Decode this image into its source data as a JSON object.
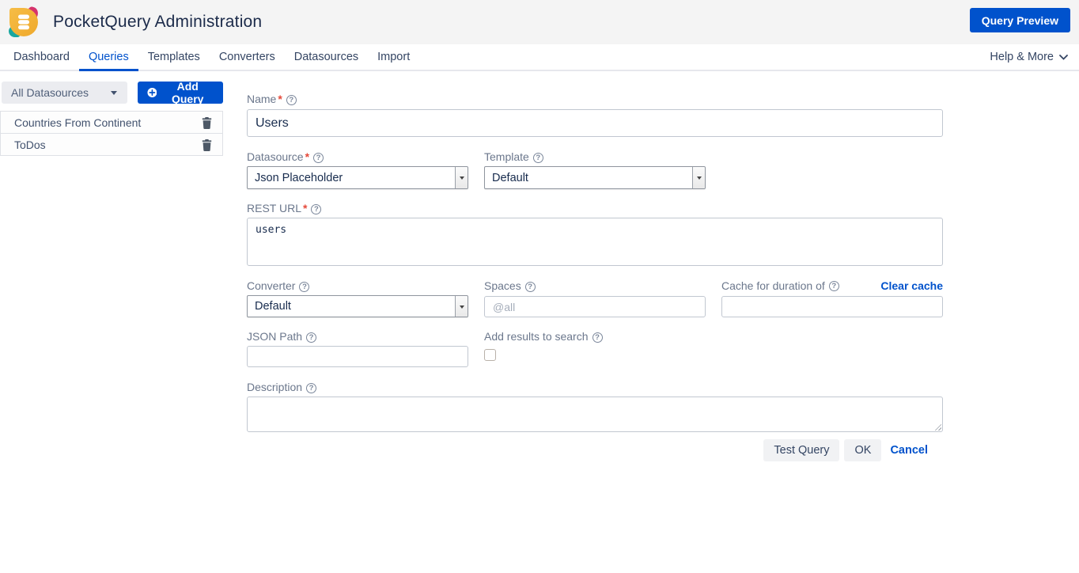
{
  "header": {
    "title": "PocketQuery Administration",
    "query_preview_label": "Query Preview"
  },
  "nav": {
    "items": [
      {
        "label": "Dashboard",
        "active": false
      },
      {
        "label": "Queries",
        "active": true
      },
      {
        "label": "Templates",
        "active": false
      },
      {
        "label": "Converters",
        "active": false
      },
      {
        "label": "Datasources",
        "active": false
      },
      {
        "label": "Import",
        "active": false
      }
    ],
    "help_label": "Help & More"
  },
  "sidebar": {
    "datasource_filter_value": "All Datasources",
    "add_query_label": "Add Query",
    "queries": [
      {
        "name": "Countries From Continent"
      },
      {
        "name": "ToDos"
      }
    ]
  },
  "form": {
    "name": {
      "label": "Name",
      "value": "Users"
    },
    "datasource": {
      "label": "Datasource",
      "value": "Json Placeholder"
    },
    "template": {
      "label": "Template",
      "value": "Default"
    },
    "rest_url": {
      "label": "REST URL",
      "value": "users"
    },
    "converter": {
      "label": "Converter",
      "value": "Default"
    },
    "spaces": {
      "label": "Spaces",
      "value": "",
      "placeholder": "@all"
    },
    "cache": {
      "label": "Cache for duration of",
      "clear_label": "Clear cache",
      "value": ""
    },
    "json_path": {
      "label": "JSON Path",
      "value": ""
    },
    "add_to_search": {
      "label": "Add results to search",
      "checked": false
    },
    "description": {
      "label": "Description",
      "value": ""
    },
    "buttons": {
      "test": "Test Query",
      "ok": "OK",
      "cancel": "Cancel"
    }
  },
  "icons": {
    "help": "?",
    "required_mark": "*"
  },
  "colors": {
    "accent": "#0052cc",
    "title": "#1c2b4a",
    "label": "#6b778c",
    "required": "#e5493a"
  }
}
